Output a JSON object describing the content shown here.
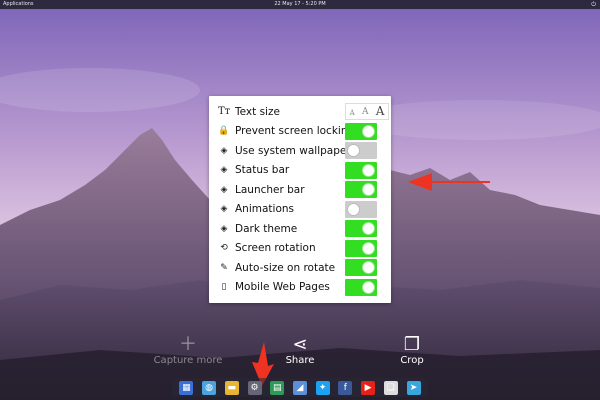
{
  "topbar": {
    "applications_label": "Applications",
    "clock": "22 May 17 - 5:20 PM",
    "power_icon": "power-icon"
  },
  "settings_panel": {
    "text_size": {
      "label": "Text size",
      "icon": "text-size-icon",
      "options": [
        "A",
        "A",
        "A"
      ]
    },
    "items": [
      {
        "label": "Prevent screen locking",
        "icon": "lock-icon",
        "glyph": "🔒",
        "on": true
      },
      {
        "label": "Use system wallpaper",
        "icon": "eye-off-icon",
        "glyph": "◈",
        "on": false
      },
      {
        "label": "Status bar",
        "icon": "eye-off-icon",
        "glyph": "◈",
        "on": true
      },
      {
        "label": "Launcher bar",
        "icon": "eye-off-icon",
        "glyph": "◈",
        "on": true
      },
      {
        "label": "Animations",
        "icon": "eye-off-icon",
        "glyph": "◈",
        "on": false
      },
      {
        "label": "Dark theme",
        "icon": "eye-off-icon",
        "glyph": "◈",
        "on": true
      },
      {
        "label": "Screen rotation",
        "icon": "rotation-icon",
        "glyph": "⟲",
        "on": true
      },
      {
        "label": "Auto-size on rotate",
        "icon": "magic-wand-icon",
        "glyph": "✎",
        "on": true
      },
      {
        "label": "Mobile Web Pages",
        "icon": "phone-icon",
        "glyph": "▯",
        "on": true
      }
    ]
  },
  "actions": {
    "capture_more": "Capture more",
    "share": "Share",
    "crop": "Crop"
  },
  "dock": {
    "items": [
      {
        "icon": "app-grid-icon",
        "color": "#3a6fd8"
      },
      {
        "icon": "globe-icon",
        "color": "#4aa3df"
      },
      {
        "icon": "folder-icon",
        "color": "#e8b631"
      },
      {
        "icon": "settings-gear-icon",
        "color": "#666677"
      },
      {
        "icon": "store-icon",
        "color": "#2f9a55"
      },
      {
        "icon": "megaphone-icon",
        "color": "#5d8fd6"
      },
      {
        "icon": "twitter-icon",
        "color": "#1da1f2"
      },
      {
        "icon": "facebook-icon",
        "color": "#3b5998"
      },
      {
        "icon": "youtube-icon",
        "color": "#e62117"
      },
      {
        "icon": "copy-icon",
        "color": "#dddddd"
      },
      {
        "icon": "telegram-icon",
        "color": "#39a6de"
      }
    ]
  },
  "accent_colors": {
    "toggle_on": "#33dd22",
    "toggle_off": "#cccccc",
    "arrow": "#ee3322"
  }
}
